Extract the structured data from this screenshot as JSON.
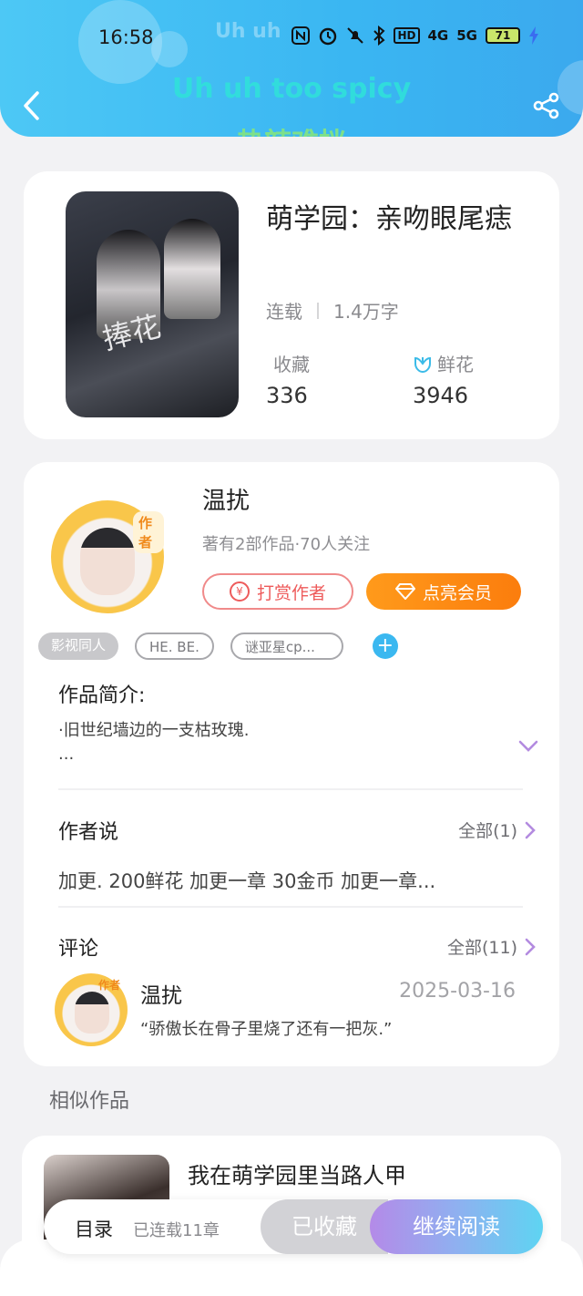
{
  "status_bar": {
    "time": "16:58",
    "icons": [
      "nfc-icon",
      "alarm-icon",
      "mute-icon",
      "bluetooth-icon"
    ],
    "hd": "HD",
    "net1": "4G",
    "net2": "5G",
    "battery": "71"
  },
  "lyrics": {
    "english": "Uh uh too spicy",
    "english_faint": "Uh uh",
    "chinese": "热辣难挡"
  },
  "book": {
    "title": "萌学园：亲吻眼尾痣",
    "status": "连载",
    "word_count": "1.4万字",
    "favorites_label": "收藏",
    "favorites_value": "336",
    "flowers_label": "鲜花",
    "flowers_value": "3946",
    "cover_script": "捧花"
  },
  "author": {
    "name": "温扰",
    "badge": "作者",
    "stats": "著有2部作品·70人关注",
    "reward_label": "打赏作者",
    "reward_icon_text": "¥",
    "vip_label": "点亮会员"
  },
  "tags": [
    "影视同人",
    "HE. BE.",
    "谜亚星cp..."
  ],
  "intro": {
    "title": "作品简介:",
    "line1": "·旧世纪墙边的一支枯玫瑰.",
    "line2": "..."
  },
  "author_say": {
    "title": "作者说",
    "more": "全部(1)",
    "text": "加更. 200鲜花 加更一章 30金币 加更一章..."
  },
  "comments": {
    "title": "评论",
    "more": "全部(11)",
    "first": {
      "name": "温扰",
      "badge": "作者",
      "date": "2025-03-16",
      "text": "“骄傲长在骨子里烧了还有一把灰.”"
    }
  },
  "similar": {
    "label": "相似作品",
    "first_title": "我在萌学园里当路人甲"
  },
  "bottom_bar": {
    "toc": "目录",
    "toc_status": "已连载11章",
    "faved": "已收藏",
    "continue": "继续阅读"
  },
  "colors": {
    "header": "#3ab6f2",
    "vip": "#fb8a14",
    "reward": "#ee5b5b",
    "accent": "#3bb8f0"
  }
}
